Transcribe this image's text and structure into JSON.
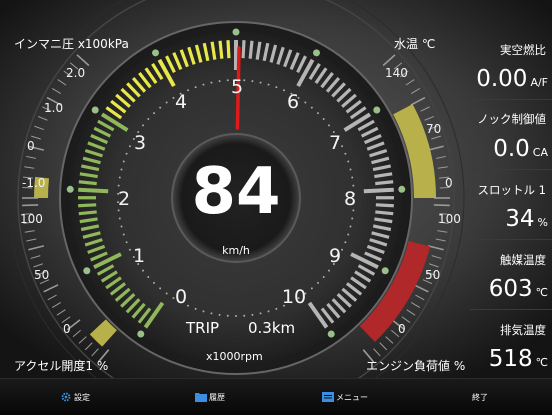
{
  "colors": {
    "green": "#8fb85a",
    "yellow": "#e8e84a",
    "gray_tick": "#b5b5b5",
    "needle": "#e01a1a",
    "red_zone": "#b0282a",
    "olive": "#b8b04a",
    "button_blue": "#3b8fe0"
  },
  "left_gauge": {
    "top_title": "インマニ圧 x100kPa",
    "top_ticks": [
      "2.0",
      "1.0",
      "0",
      "-1.0"
    ],
    "bottom_title": "アクセル開度1 %",
    "bottom_ticks": [
      "100",
      "50",
      "0"
    ]
  },
  "center_gauge": {
    "rpm_numbers": [
      "0",
      "1",
      "2",
      "3",
      "4",
      "5",
      "6",
      "7",
      "8",
      "9",
      "10"
    ],
    "rpm_value": 5.04,
    "speed": "84",
    "speed_unit": "km/h",
    "rpm_unit": "x1000rpm",
    "trip_label": "TRIP",
    "trip_value": "0.3km"
  },
  "right_gauge": {
    "top_title": "水温 ℃",
    "top_ticks": [
      "140",
      "70",
      "0"
    ],
    "bottom_title": "エンジン負荷値 %",
    "bottom_ticks": [
      "100",
      "50",
      "0"
    ]
  },
  "right_panel": {
    "items": [
      {
        "title": "実空燃比",
        "value": "0.00",
        "unit": "A/F"
      },
      {
        "title": "ノック制御値",
        "value": "0.0",
        "unit": "CA"
      },
      {
        "title": "スロットル 1",
        "value": "34",
        "unit": "%"
      },
      {
        "title": "触媒温度",
        "value": "603",
        "unit": "℃"
      },
      {
        "title": "排気温度",
        "value": "518",
        "unit": "℃"
      }
    ]
  },
  "bottom_bar": {
    "settings_label": "設定",
    "history_label": "履歴",
    "menu_label": "メニュー",
    "exit_label": "終了"
  }
}
